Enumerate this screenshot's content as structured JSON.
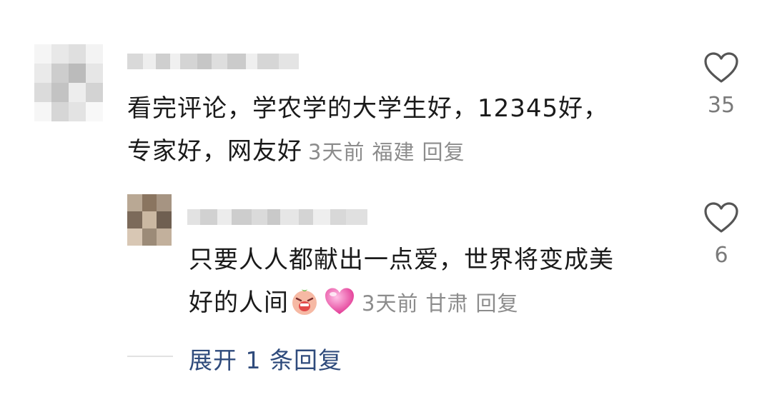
{
  "comments": [
    {
      "text_line1": "看完评论，学农学的大学生好，12345好，",
      "text_line2": "专家好，网友好",
      "time": "3天前",
      "location": "福建",
      "reply_label": "回复",
      "likes": "35"
    },
    {
      "text_line1": "只要人人都献出一点爱，世界将变成美",
      "text_line2": "好的人间",
      "time": "3天前",
      "location": "甘肃",
      "reply_label": "回复",
      "likes": "6"
    }
  ],
  "expand_replies": "展开 1 条回复",
  "icons": {
    "like": "heart-outline-icon",
    "emoji1": "crying-peach-emoji",
    "emoji2": "pink-heart-emoji"
  },
  "colors": {
    "text": "#1a1a1a",
    "meta": "#8c8c8c",
    "link": "#2f4b7c"
  }
}
